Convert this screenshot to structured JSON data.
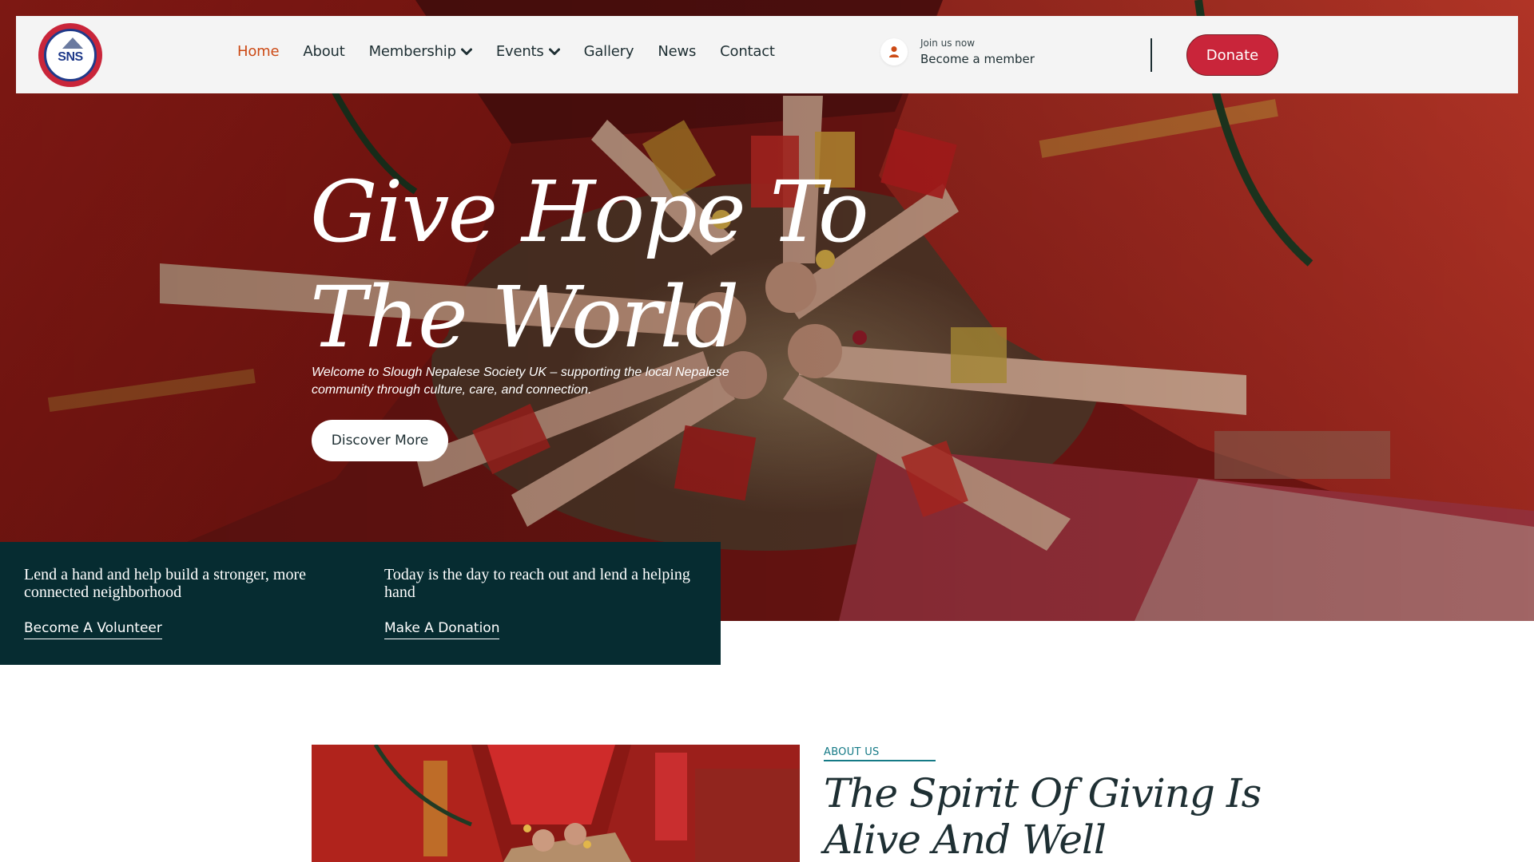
{
  "brand": {
    "logo_text": "SNS"
  },
  "nav": {
    "items": [
      {
        "label": "Home",
        "active": true
      },
      {
        "label": "About"
      },
      {
        "label": "Membership",
        "dropdown": true
      },
      {
        "label": "Events",
        "dropdown": true
      },
      {
        "label": "Gallery"
      },
      {
        "label": "News"
      },
      {
        "label": "Contact"
      }
    ]
  },
  "join": {
    "small": "Join us now",
    "big": "Become a member",
    "icon": "user-icon"
  },
  "donate_label": "Donate",
  "hero": {
    "title_line1": "Give Hope To",
    "title_line2": "The World",
    "subtitle": "Welcome to Slough Nepalese Society UK – supporting the local Nepalese community through culture, care, and connection.",
    "button_label": "Discover More"
  },
  "cta": [
    {
      "text": "Lend a hand and help build a stronger, more connected neighborhood",
      "link": "Become A Volunteer"
    },
    {
      "text": "Today is the day to reach out and lend a helping hand",
      "link": "Make A Donation"
    }
  ],
  "about": {
    "eyebrow": "ABOUT US",
    "title": "The Spirit Of Giving Is Alive And Well"
  },
  "colors": {
    "accent_red": "#c9253a",
    "nav_active": "#cc4a15",
    "cta_bg": "#062c31",
    "eyebrow": "#157a86"
  }
}
